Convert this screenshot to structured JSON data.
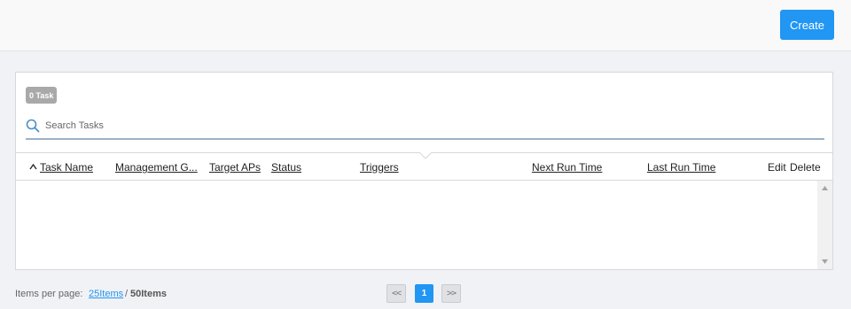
{
  "toolbar": {
    "create_label": "Create"
  },
  "panel": {
    "task_count": "0 Task",
    "search": {
      "placeholder": "Search Tasks",
      "value": ""
    },
    "columns": {
      "task_name": "Task Name",
      "management_group": "Management G...",
      "target_aps": "Target APs",
      "status": "Status",
      "triggers": "Triggers",
      "next_run_time": "Next Run Time",
      "last_run_time": "Last Run Time",
      "edit": "Edit",
      "delete": "Delete"
    },
    "rows": []
  },
  "pagination": {
    "items_per_page_label": "Items per page:",
    "option_25": "25Items",
    "separator": "/",
    "option_50": "50Items",
    "prev": "<<",
    "current_page": "1",
    "next": ">>"
  },
  "colors": {
    "accent": "#2196f3",
    "badge": "#a9a9a9",
    "search_underline": "#9bb2c8"
  },
  "icons": {
    "search": "search-icon",
    "sort": "sort-asc-icon"
  }
}
